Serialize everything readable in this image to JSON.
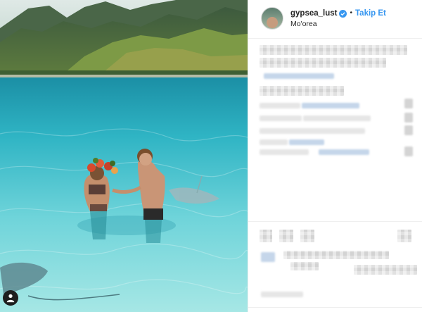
{
  "post": {
    "username": "gypsea_lust",
    "separator": "•",
    "follow_label": "Takip Et",
    "location": "Mo'orea",
    "verified_icon": "verified-badge-icon",
    "tag_icon": "user-tag-icon"
  },
  "colors": {
    "accent": "#3897f0",
    "text": "#262626",
    "divider": "#efefef"
  }
}
